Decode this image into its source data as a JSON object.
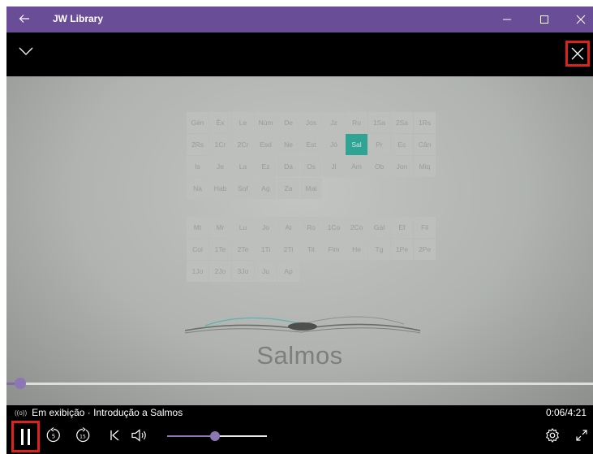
{
  "window": {
    "title": "JW Library",
    "titlebar_color": "#6a4d97"
  },
  "video": {
    "book_title": "Salmos",
    "ot_books": [
      "Gén",
      "Êx",
      "Le",
      "Núm",
      "De",
      "Jos",
      "Jz",
      "Ru",
      "1Sa",
      "2Sa",
      "1Rs",
      "2Rs",
      "1Cr",
      "2Cr",
      "Esd",
      "Ne",
      "Est",
      "Jó",
      "Sal",
      "Pr",
      "Ec",
      "Cân",
      "Is",
      "Je",
      "La",
      "Ez",
      "Da",
      "Os",
      "Jl",
      "Am",
      "Ob",
      "Jon",
      "Miq",
      "Na",
      "Hab",
      "Sof",
      "Ag",
      "Za",
      "Mal"
    ],
    "nt_books": [
      "Mt",
      "Mr",
      "Lu",
      "Jo",
      "At",
      "Ro",
      "1Co",
      "2Co",
      "Gál",
      "Ef",
      "Fil",
      "Col",
      "1Te",
      "2Te",
      "1Ti",
      "2Ti",
      "Tit",
      "Flm",
      "He",
      "Tg",
      "1Pe",
      "2Pe",
      "1Jo",
      "2Jo",
      "3Jo",
      "Ju",
      "Ap"
    ],
    "highlighted_book": "Sal",
    "highlight_color": "#2fa394"
  },
  "player": {
    "now_playing_label": "Em exibição · Introdução a Salmos",
    "time": "0:06/4:21",
    "progress_fraction": 0.023,
    "volume_fraction": 0.48,
    "accent_color": "#8c76b4",
    "icons": [
      "pause-icon",
      "replay-5-icon",
      "forward-15-icon",
      "previous-icon",
      "volume-icon",
      "settings-icon",
      "fullscreen-icon"
    ]
  }
}
